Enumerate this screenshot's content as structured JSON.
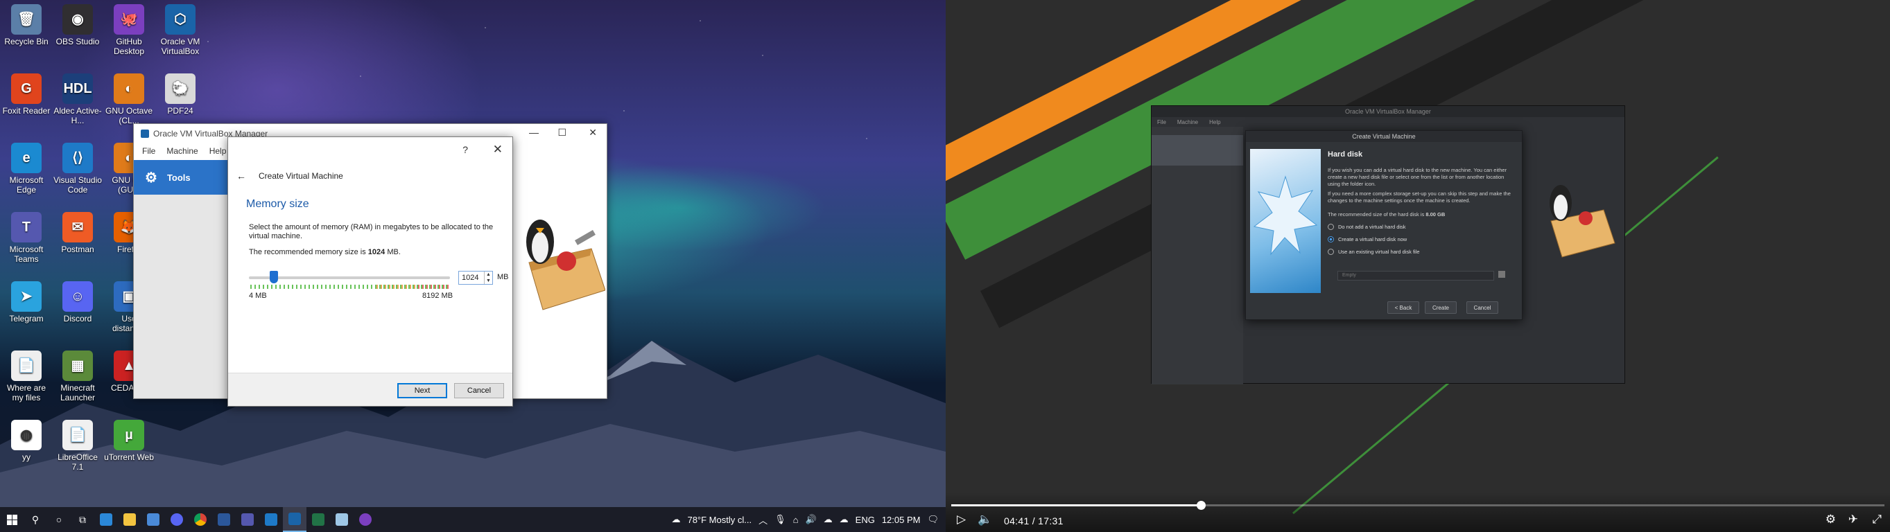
{
  "desktop": {
    "icons": [
      {
        "label": "Recycle Bin",
        "color": "#5b7fa8",
        "glyph": "🗑"
      },
      {
        "label": "OBS Studio",
        "color": "#302e31",
        "glyph": "◉"
      },
      {
        "label": "GitHub Desktop",
        "color": "#7b3fbf",
        "glyph": "🐙"
      },
      {
        "label": "Oracle VM VirtualBox",
        "color": "#1a64a8",
        "glyph": "⬡"
      },
      {
        "label": "Foxit Reader",
        "color": "#e0441d",
        "glyph": "G"
      },
      {
        "label": "Aldec Active-H...",
        "color": "#1c3f7a",
        "glyph": "HDL"
      },
      {
        "label": "GNU Octave (CL...",
        "color": "#e07b1a",
        "glyph": "◐"
      },
      {
        "label": "PDF24",
        "color": "#d9d9d9",
        "glyph": "🐑"
      },
      {
        "label": "Microsoft Edge",
        "color": "#1b8ad1",
        "glyph": "e"
      },
      {
        "label": "Visual Studio Code",
        "color": "#1e7ac8",
        "glyph": "⟨⟩"
      },
      {
        "label": "GNU O... (GU...",
        "color": "#e07b1a",
        "glyph": "◐"
      },
      {
        "label": "Microsoft Teams",
        "color": "#5558af",
        "glyph": "T"
      },
      {
        "label": "Postman",
        "color": "#ef5b25",
        "glyph": "✉"
      },
      {
        "label": "Firef...",
        "color": "#e66000",
        "glyph": "🦊"
      },
      {
        "label": "Telegram",
        "color": "#2aa3de",
        "glyph": "➤"
      },
      {
        "label": "Discord",
        "color": "#5865f2",
        "glyph": "☺"
      },
      {
        "label": "Uso distanc...",
        "color": "#2d6bbf",
        "glyph": "▣"
      },
      {
        "label": "Where are my files",
        "color": "#eeeeee",
        "glyph": "📄"
      },
      {
        "label": "Minecraft Launcher",
        "color": "#5b8a3a",
        "glyph": "▦"
      },
      {
        "label": "CEDAR...",
        "color": "#cc2222",
        "glyph": "▲"
      },
      {
        "label": "yy",
        "color": "#ffffff",
        "glyph": "◍"
      },
      {
        "label": "LibreOffice 7.1",
        "color": "#f0f0f0",
        "glyph": "📄"
      },
      {
        "label": "uTorrent Web",
        "color": "#44a83a",
        "glyph": "µ"
      }
    ]
  },
  "vbox_manager": {
    "title": "Oracle VM VirtualBox Manager",
    "menu": [
      "File",
      "Machine",
      "Help"
    ],
    "tools_label": "Tools"
  },
  "wizard": {
    "title": "Create Virtual Machine",
    "help": "?",
    "heading": "Memory size",
    "description": "Select the amount of memory (RAM) in megabytes to be allocated to the virtual machine.",
    "recommended_prefix": "The recommended memory size is ",
    "recommended_value": "1024",
    "recommended_suffix": " MB.",
    "memory_value": "1024",
    "memory_unit": "MB",
    "slider_min": "4 MB",
    "slider_max": "8192 MB",
    "slider_fraction": 0.125,
    "next_label": "Next",
    "cancel_label": "Cancel"
  },
  "taskbar": {
    "weather": "78°F  Mostly cl...",
    "language": "ENG",
    "time": "12:05 PM"
  },
  "player": {
    "vm_window_title": "Oracle VM VirtualBox Manager",
    "vm_menu": [
      "File",
      "Machine",
      "Help"
    ],
    "dialog_title": "Create Virtual Machine",
    "dialog_heading": "Hard disk",
    "dialog_p1": "If you wish you can add a virtual hard disk to the new machine. You can either create a new hard disk file or select one from the list or from another location using the folder icon.",
    "dialog_p2": "If you need a more complex storage set-up you can skip this step and make the changes to the machine settings once the machine is created.",
    "dialog_p3_prefix": "The recommended size of the hard disk is ",
    "dialog_p3_value": "8.00 GB",
    "options": [
      "Do not add a virtual hard disk",
      "Create a virtual hard disk now",
      "Use an existing virtual hard disk file"
    ],
    "selected_option": 1,
    "combo_placeholder": "Empty",
    "back_label": "< Back",
    "create_label": "Create",
    "cancel_label": "Cancel",
    "current_time": "04:41",
    "separator": "/",
    "total_time": "17:31",
    "progress_fraction": 0.2678
  },
  "colors": {
    "accent_blue": "#2b73c8",
    "stripe_orange": "#f08a1e",
    "stripe_green": "#3e8f3a"
  }
}
